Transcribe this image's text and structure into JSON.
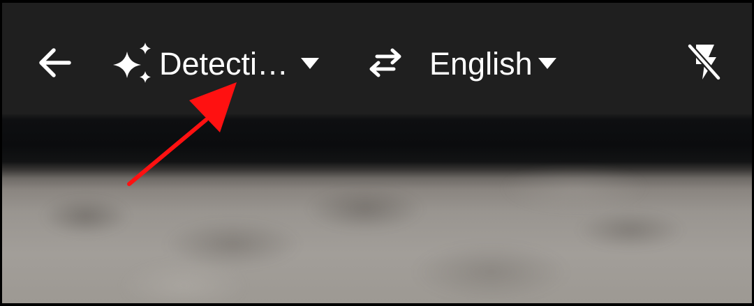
{
  "toolbar": {
    "back_icon": "arrow-back-icon",
    "source_language": {
      "label": "Detecti…",
      "icon": "auto-detect-sparkle-icon",
      "dropdown_icon": "dropdown-caret-icon"
    },
    "swap_icon": "swap-languages-icon",
    "target_language": {
      "label": "English",
      "dropdown_icon": "dropdown-caret-icon"
    },
    "flash_icon": "flash-off-icon"
  },
  "annotation": {
    "type": "red-arrow",
    "color": "#ff1111"
  },
  "colors": {
    "toolbar_background": "#1f1f1f",
    "icon_color": "#ffffff",
    "frame_border": "#000000"
  }
}
